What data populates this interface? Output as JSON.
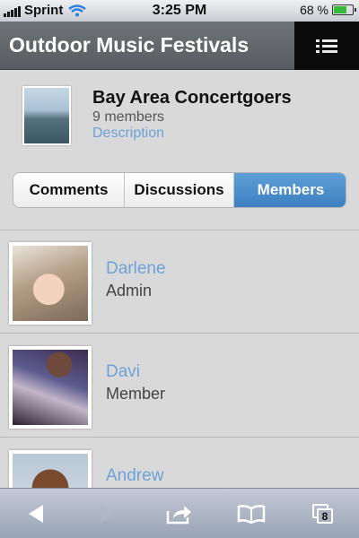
{
  "statusbar": {
    "carrier": "Sprint",
    "time": "3:25 PM",
    "battery": "68 %",
    "battery_level": 0.68
  },
  "header": {
    "title": "Outdoor Music Festivals",
    "menu_icon": "list-menu-icon"
  },
  "group": {
    "name": "Bay Area Concertgoers",
    "member_count": "9 members",
    "description_link": "Description"
  },
  "tabs": [
    {
      "label": "Comments",
      "active": false
    },
    {
      "label": "Discussions",
      "active": false
    },
    {
      "label": "Members",
      "active": true
    }
  ],
  "members": [
    {
      "name": "Darlene",
      "role": "Admin"
    },
    {
      "name": "Davi",
      "role": "Member"
    },
    {
      "name": "Andrew",
      "role": ""
    }
  ],
  "toolbar": {
    "tab_count": "8",
    "icons": [
      "back-arrow-icon",
      "forward-arrow-icon",
      "share-icon",
      "bookmarks-icon",
      "tabs-icon"
    ]
  },
  "colors": {
    "accent": "#3d7fc0",
    "link": "#6da2d8",
    "titlebar": "#5f6368"
  }
}
